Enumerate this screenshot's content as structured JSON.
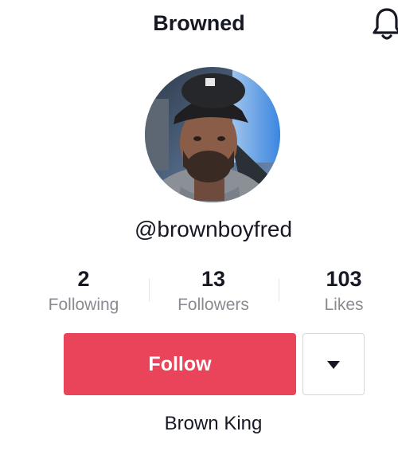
{
  "header": {
    "title": "Browned",
    "bell_icon": "bell-icon"
  },
  "profile": {
    "avatar_icon": "avatar",
    "handle": "@brownboyfred",
    "bio_name": "Brown King"
  },
  "stats": [
    {
      "value": "2",
      "label": "Following"
    },
    {
      "value": "13",
      "label": "Followers"
    },
    {
      "value": "103",
      "label": "Likes"
    }
  ],
  "actions": {
    "follow_label": "Follow",
    "follow_color": "#ea445a",
    "dropdown_icon": "caret-down-icon"
  }
}
